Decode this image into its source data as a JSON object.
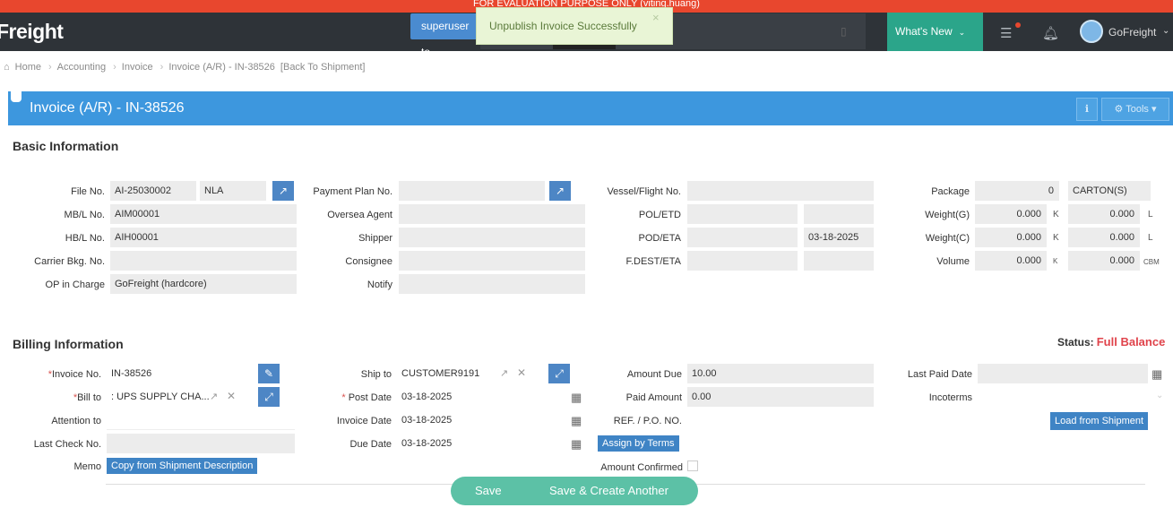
{
  "banner": {
    "text": "FOR EVALUATION PURPOSE ONLY (viting.huang)"
  },
  "nav": {
    "logo": "Freight",
    "user_chip": "superuser to",
    "whats_new": "What's New",
    "username": "GoFreight"
  },
  "toast": {
    "message": "Unpublish Invoice Successfully",
    "close": "×"
  },
  "breadcrumb": {
    "home": "Home",
    "accounting": "Accounting",
    "invoice": "Invoice",
    "current": "Invoice (A/R) - IN-38526",
    "back": "[Back To Shipment]"
  },
  "header": {
    "title": "Invoice (A/R) - IN-38526",
    "tools": "Tools"
  },
  "basic": {
    "title": "Basic Information",
    "labels": {
      "file_no": "File No.",
      "mbl_no": "MB/L No.",
      "hbl_no": "HB/L No.",
      "carrier_bkg": "Carrier Bkg. No.",
      "op_in_charge": "OP in Charge",
      "payment_plan": "Payment Plan No.",
      "oversea_agent": "Oversea Agent",
      "shipper": "Shipper",
      "consignee": "Consignee",
      "notify": "Notify",
      "vessel_flight": "Vessel/Flight No.",
      "pol_etd": "POL/ETD",
      "pod_eta": "POD/ETA",
      "fdest_eta": "F.DEST/ETA",
      "package": "Package",
      "weight_g": "Weight(G)",
      "weight_c": "Weight(C)",
      "volume": "Volume"
    },
    "values": {
      "file_no": "AI-25030002",
      "file_type": "NLA",
      "mbl_no": "AIM00001",
      "hbl_no": "AIH00001",
      "carrier_bkg": "",
      "op_in_charge": "GoFreight (hardcore)",
      "pod_eta_date": "03-18-2025",
      "package_count": "0",
      "package_unit": "CARTON(S)",
      "weight_g_k": "0.000",
      "weight_g_l": "0.000",
      "weight_c_k": "0.000",
      "weight_c_l": "0.000",
      "volume_k": "0.000",
      "volume_cbm": "0.000"
    },
    "units": {
      "k": "K",
      "l": "L",
      "cbm": "CBM"
    }
  },
  "billing": {
    "title": "Billing Information",
    "status_label": "Status:",
    "status_value": "Full Balance",
    "labels": {
      "invoice_no": "Invoice No.",
      "bill_to": "Bill to",
      "attention_to": "Attention to",
      "last_check_no": "Last Check No.",
      "memo": "Memo",
      "ship_to": "Ship to",
      "post_date": "Post Date",
      "invoice_date": "Invoice Date",
      "due_date": "Due Date",
      "amount_due": "Amount Due",
      "paid_amount": "Paid Amount",
      "ref_po": "REF. / P.O. NO.",
      "amount_confirmed": "Amount Confirmed",
      "last_paid_date": "Last Paid Date",
      "incoterms": "Incoterms"
    },
    "values": {
      "invoice_no": "IN-38526",
      "bill_to": ": UPS SUPPLY CHA...",
      "ship_to": "CUSTOMER9191",
      "post_date": "03-18-2025",
      "invoice_date": "03-18-2025",
      "due_date": "03-18-2025",
      "amount_due": "10.00",
      "paid_amount": "0.00"
    },
    "buttons": {
      "copy_from_shipment": "Copy from Shipment Description",
      "assign_by_terms": "Assign by Terms",
      "load_from_shipment": "Load from Shipment"
    }
  },
  "actions": {
    "save": "Save",
    "save_create_another": "Save & Create Another"
  }
}
